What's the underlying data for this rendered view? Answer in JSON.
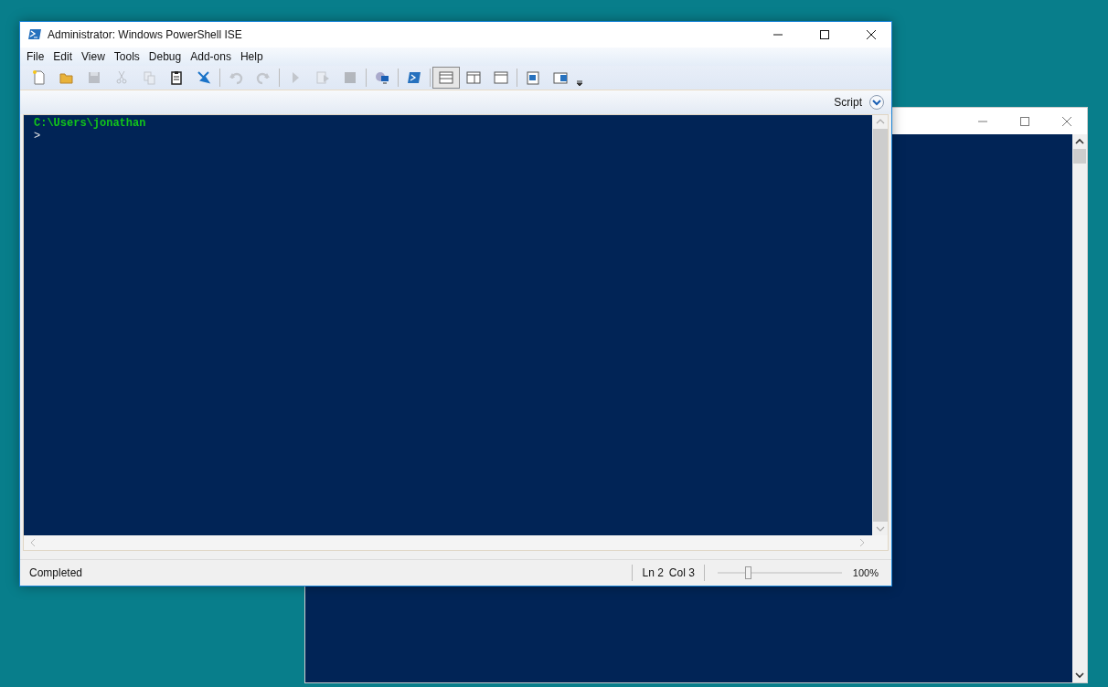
{
  "window": {
    "title": "Administrator: Windows PowerShell ISE"
  },
  "menu": [
    "File",
    "Edit",
    "View",
    "Tools",
    "Debug",
    "Add-ons",
    "Help"
  ],
  "toolbar": [
    {
      "kind": "new",
      "disabled": false
    },
    {
      "kind": "open",
      "disabled": false
    },
    {
      "kind": "save",
      "disabled": true
    },
    {
      "kind": "cut",
      "disabled": true
    },
    {
      "kind": "copy",
      "disabled": true
    },
    {
      "kind": "paste",
      "disabled": false
    },
    {
      "kind": "clear",
      "disabled": false
    },
    {
      "kind": "sep"
    },
    {
      "kind": "undo",
      "disabled": true
    },
    {
      "kind": "redo",
      "disabled": true
    },
    {
      "kind": "sep"
    },
    {
      "kind": "run",
      "disabled": true
    },
    {
      "kind": "runsel",
      "disabled": true
    },
    {
      "kind": "stop",
      "disabled": true
    },
    {
      "kind": "sep"
    },
    {
      "kind": "remote",
      "disabled": false
    },
    {
      "kind": "sep"
    },
    {
      "kind": "console",
      "disabled": false
    },
    {
      "kind": "sep"
    },
    {
      "kind": "layout-top",
      "selected": true
    },
    {
      "kind": "layout-right",
      "selected": false
    },
    {
      "kind": "layout-max",
      "selected": false
    },
    {
      "kind": "sep"
    },
    {
      "kind": "pane-script",
      "disabled": false
    },
    {
      "kind": "pane-command",
      "disabled": false
    },
    {
      "kind": "overflow"
    }
  ],
  "script_bar": {
    "label": "Script",
    "expanded": false
  },
  "console": {
    "path": "C:\\Users\\jonathan",
    "prompt": ">"
  },
  "status_bar": {
    "status": "Completed",
    "line": "Ln 2",
    "column": "Col 3",
    "zoom": {
      "level": 0.25,
      "reading": "100%"
    }
  }
}
